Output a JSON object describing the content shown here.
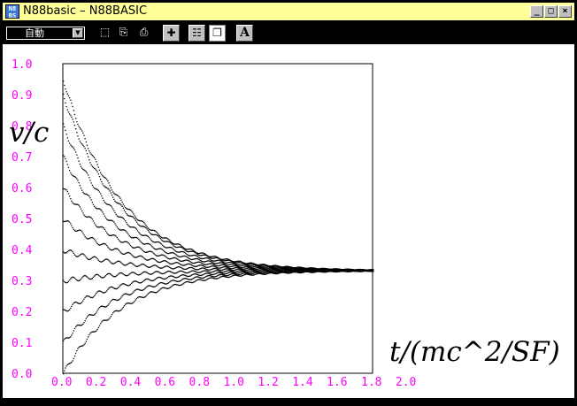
{
  "window": {
    "title": "N88basic – N88BASIC",
    "icon_text": "N88\nBS",
    "controls": {
      "minimize": "_",
      "maximize": "□",
      "close": "×"
    }
  },
  "toolbar": {
    "mode_select": "自動",
    "buttons": [
      {
        "name": "select-rect-icon",
        "glyph": "⬚"
      },
      {
        "name": "copy-icon",
        "glyph": "⎘"
      },
      {
        "name": "paste-icon",
        "glyph": "⎙"
      },
      {
        "name": "fit-window-icon",
        "glyph": "✚"
      },
      {
        "name": "properties-icon",
        "glyph": "☷"
      },
      {
        "name": "window-mode-icon",
        "glyph": "❐"
      },
      {
        "name": "font-icon",
        "glyph": "A"
      }
    ]
  },
  "chart_data": {
    "type": "scatter",
    "xlabel": "t/(mc^2/SF)",
    "ylabel": "v/c",
    "xlim": [
      0.0,
      1.8
    ],
    "ylim": [
      0.0,
      1.0
    ],
    "x_ticks": [
      "0.0",
      "0.2",
      "0.4",
      "0.6",
      "0.8",
      "1.0",
      "1.2",
      "1.4",
      "1.6",
      "1.8",
      "2.0"
    ],
    "y_ticks": [
      "0.0",
      "0.1",
      "0.2",
      "0.3",
      "0.4",
      "0.5",
      "0.6",
      "0.7",
      "0.8",
      "0.9",
      "1.0"
    ],
    "grid": false,
    "equilibrium": 0.333,
    "initial_values": [
      0.0,
      0.1,
      0.2,
      0.3,
      0.4,
      0.5,
      0.6,
      0.7,
      0.8,
      0.9,
      0.95
    ],
    "decay_rate": 3.0,
    "sample_step": 0.006,
    "color": "#000000",
    "tick_color": "#ff00ff"
  }
}
